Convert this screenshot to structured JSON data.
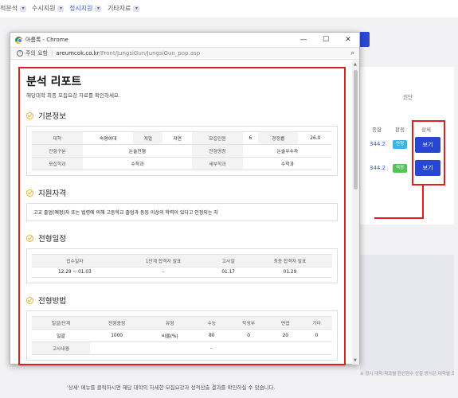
{
  "bg": {
    "nav": [
      {
        "label": "적분석",
        "active": false
      },
      {
        "label": "수시지원",
        "active": false
      },
      {
        "label": "정시지원",
        "active": true
      },
      {
        "label": "기타자료",
        "active": false
      }
    ],
    "col_group": "진단",
    "col_total": "종합",
    "col_judge": "판정",
    "col_detail": "상세",
    "rows": [
      {
        "score": "344.2",
        "badge": "안정",
        "badge_color": "#39b6e8",
        "button": "보기"
      },
      {
        "score": "344.2",
        "badge": "적정",
        "badge_color": "#56c25a",
        "button": "보기"
      }
    ],
    "strip_text": "※ 정시 대학·학과별 환산점수 산출 방식은 대학별 모집요강을 반드시 확인해 주세요.",
    "footer": "'상세' 메뉴를 클릭하시면 해당 대학의 자세한 모집요강과 성적산출 결과를 확인하실 수 있습니다."
  },
  "popup": {
    "title": "아름록 - Chrome",
    "win_min": "—",
    "win_max": "☐",
    "win_close": "✕",
    "security": "주의 요함",
    "url_host": "areumcok.co.kr",
    "url_path": "/Front/JungsiGun/JungsiGun_pop.asp",
    "report_title": "분석 리포트",
    "report_sub": "해당대학 최종 모집요강 자료를 확인하세요.",
    "sections": {
      "basic": "기본정보",
      "qual": "지원자격",
      "schedule": "전형일정",
      "method": "전형방법"
    },
    "basic": {
      "r1": [
        "대학",
        "숙명여대",
        "계열",
        "자연",
        "모집인원",
        "6",
        "경쟁률",
        "26.0"
      ],
      "r2": [
        "전형구분",
        "논술전형",
        "전형명칭",
        "논술우수자"
      ],
      "r3": [
        "모집학과",
        "수학과",
        "세부학과",
        "수학과"
      ]
    },
    "qual_text": "고교 졸업(예정)자 또는 법령에 의해 고등학교 졸업과 동등 이상의 학력이 있다고 인정되는 자",
    "schedule": {
      "headers": [
        "접수일자",
        "1단계 합격자 발표",
        "고사일",
        "최종 합격자 발표"
      ],
      "values": [
        "12.29 ~ 01.03",
        "-",
        "01.17",
        "01.29"
      ]
    },
    "method": {
      "headers": [
        "일괄/단계",
        "전형총점",
        "유형",
        "수능",
        "학생부",
        "면접",
        "기타"
      ],
      "values": [
        "일괄",
        "1000",
        "비율(%)",
        "80",
        "0",
        "20",
        "0"
      ],
      "exam_label": "고사내용",
      "exam_value": "-"
    }
  }
}
